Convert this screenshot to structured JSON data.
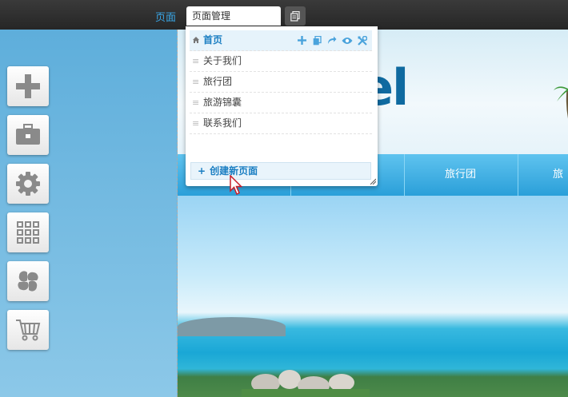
{
  "topbar": {
    "section_label": "页面",
    "active_tab": "页面管理"
  },
  "sidebar": {
    "tools": [
      {
        "icon": "plus-icon"
      },
      {
        "icon": "toolbox-icon"
      },
      {
        "icon": "gear-icon"
      },
      {
        "icon": "grid-icon"
      },
      {
        "icon": "clover-icon"
      },
      {
        "icon": "cart-icon"
      }
    ]
  },
  "page_manager": {
    "pages": [
      {
        "label": "首页",
        "home": true
      },
      {
        "label": "关于我们"
      },
      {
        "label": "旅行团"
      },
      {
        "label": "旅游锦囊"
      },
      {
        "label": "联系我们"
      }
    ],
    "row_actions": [
      "add-icon",
      "copy-icon",
      "redirect-icon",
      "preview-icon",
      "settings-icon"
    ],
    "create_button": "创建新页面"
  },
  "site": {
    "logo_text": "el",
    "nav_items": [
      "旅行团",
      "旅游"
    ]
  },
  "colors": {
    "accent": "#1a7ec2",
    "topbar": "#2c2c2c",
    "nav": "#39aee3"
  }
}
